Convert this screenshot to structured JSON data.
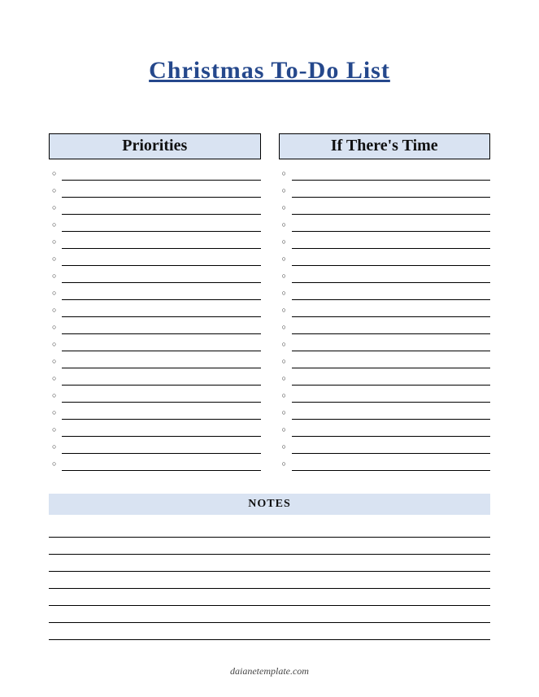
{
  "title": "Christmas To-Do List",
  "columns": {
    "priorities": {
      "header": "Priorities",
      "row_count": 18
    },
    "if_time": {
      "header": "If There's Time",
      "row_count": 18
    }
  },
  "notes": {
    "header": "NOTES",
    "line_count": 7
  },
  "footer": "daianetemplate.com",
  "bullet_glyph": "○"
}
